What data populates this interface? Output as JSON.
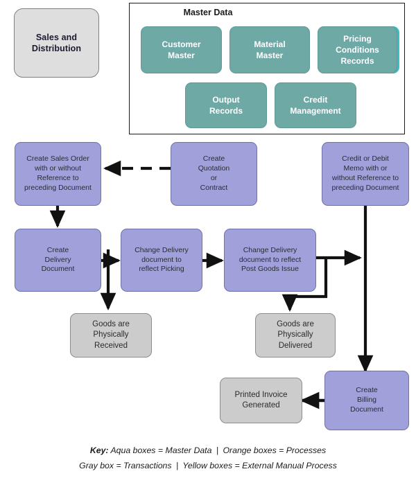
{
  "diagram": {
    "module": {
      "label_line1": "Sales and",
      "label_line2": "Distribution"
    },
    "master_data": {
      "title": "Master Data",
      "boxes": [
        {
          "id": "customer-master",
          "label_line1": "Customer",
          "label_line2": "Master"
        },
        {
          "id": "material-master",
          "label_line1": "Material",
          "label_line2": "Master"
        },
        {
          "id": "pricing-conditions-records",
          "label_line1": "Pricing",
          "label_line2": "Conditions",
          "label_line3": "Records"
        },
        {
          "id": "output-records",
          "label_line1": "Output",
          "label_line2": "Records"
        },
        {
          "id": "credit-management",
          "label_line1": "Credit",
          "label_line2": "Management"
        }
      ]
    },
    "process_nodes": {
      "create_sales_order": {
        "line1": "Create Sales Order",
        "line2": "with or without",
        "line3": "Reference to",
        "line4": "preceding Document"
      },
      "create_quotation": {
        "line1": "Create",
        "line2": "Quotation",
        "line3": "or",
        "line4": "Contract"
      },
      "credit_debit_memo": {
        "line1": "Credit or Debit",
        "line2": "Memo with or",
        "line3": "without Reference to",
        "line4": "preceding Document"
      },
      "create_delivery_document": {
        "line1": "Create",
        "line2": "Delivery",
        "line3": "Document"
      },
      "change_delivery_picking": {
        "line1": "Change Delivery",
        "line2": "document to",
        "line3": "reflect Picking"
      },
      "change_delivery_pgi": {
        "line1": "Change Delivery",
        "line2": "document to reflect",
        "line3": "Post Goods Issue"
      },
      "create_billing_document": {
        "line1": "Create",
        "line2": "Billing",
        "line3": "Document"
      }
    },
    "transaction_nodes": {
      "goods_received": {
        "line1": "Goods are",
        "line2": "Physically",
        "line3": "Received"
      },
      "goods_delivered": {
        "line1": "Goods are",
        "line2": "Physically",
        "line3": "Delivered"
      },
      "printed_invoice": {
        "line1": "Printed Invoice",
        "line2": "Generated"
      }
    },
    "legend": {
      "key_label": "Key:",
      "line1_part1": "Aqua boxes = Master Data",
      "line1_sep": "|",
      "line1_part2": "Orange boxes = Processes",
      "line2_part1": "Gray box = Transactions",
      "line2_sep": "|",
      "line2_part2": "Yellow boxes = External Manual Process"
    },
    "colors": {
      "aqua": "#6ea9a6",
      "aqua_shadow": "#3dbcc6",
      "purple": "#a0a1da",
      "gray": "#cccccc",
      "module_gray": "#dedede",
      "connector": "#111111"
    }
  }
}
